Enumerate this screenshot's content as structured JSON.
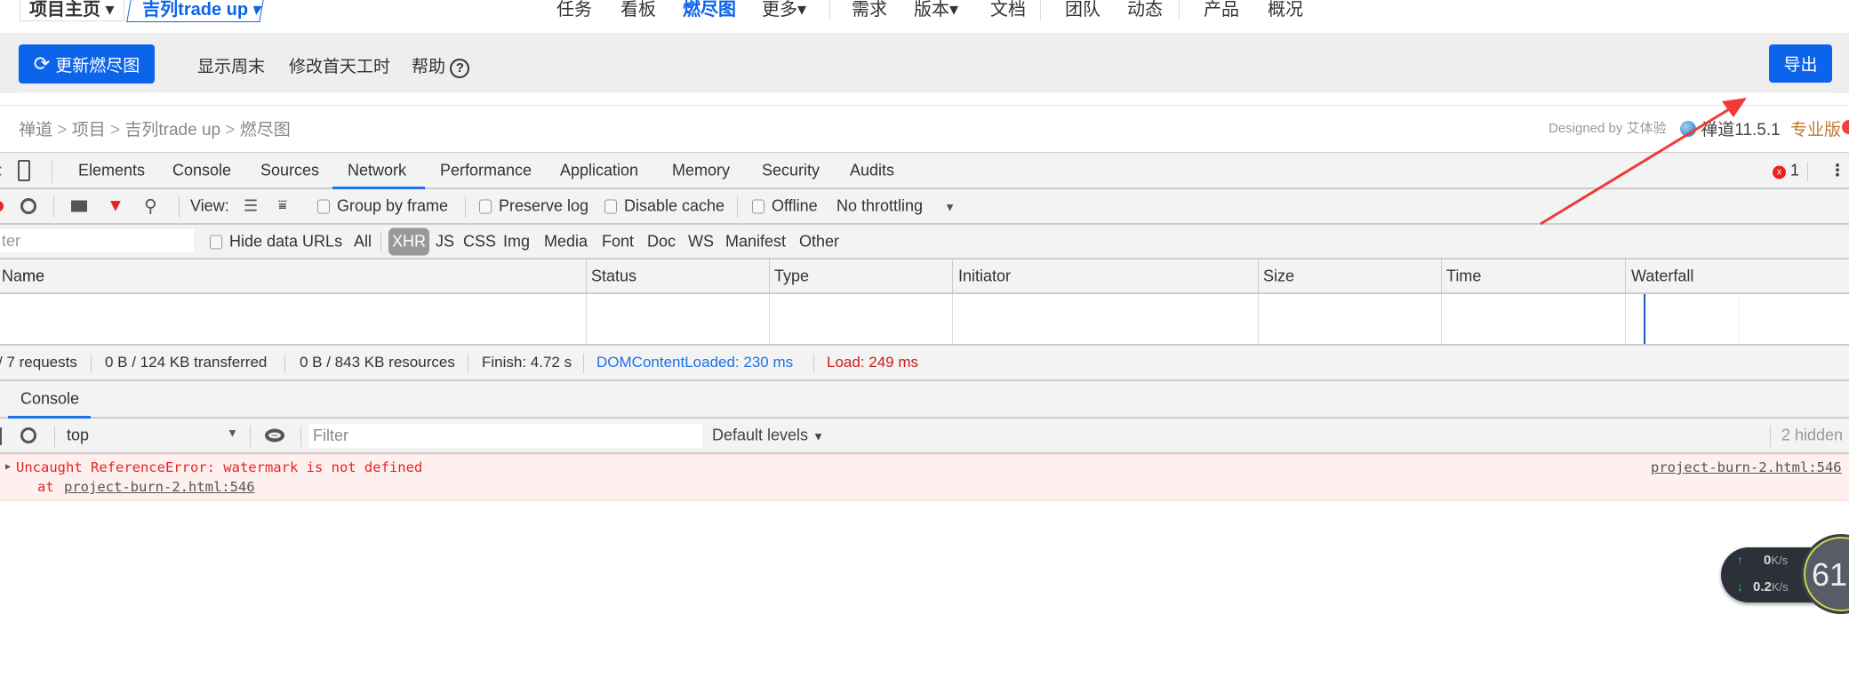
{
  "topnav": {
    "home": "项目主页",
    "project": "吉列trade up",
    "items": [
      "任务",
      "看板",
      "燃尽图",
      "更多",
      "需求",
      "版本",
      "文档",
      "团队",
      "动态",
      "产品",
      "概况"
    ],
    "active": "燃尽图"
  },
  "toolbar": {
    "refresh": "更新燃尽图",
    "show_weekend": "显示周末",
    "edit_hours": "修改首天工时",
    "help": "帮助",
    "export": "导出"
  },
  "breadcrumb": [
    "禅道",
    ">",
    "项目",
    ">",
    "吉列trade up",
    ">",
    "燃尽图"
  ],
  "footer": {
    "designed": "Designed by",
    "designer": "艾体验",
    "product": "禅道11.5.1",
    "edition": "专业版"
  },
  "devtools": {
    "tabs": [
      "Elements",
      "Console",
      "Sources",
      "Network",
      "Performance",
      "Application",
      "Memory",
      "Security",
      "Audits"
    ],
    "active_tab": "Network",
    "error_count": "1",
    "toolbar": {
      "view": "View:",
      "group": "Group by frame",
      "preserve": "Preserve log",
      "disable": "Disable cache",
      "offline": "Offline",
      "throttle": "No throttling"
    },
    "filter": {
      "placeholder": "Filter",
      "partial": "ter",
      "hide_data": "Hide data URLs",
      "types": [
        "All",
        "XHR",
        "JS",
        "CSS",
        "Img",
        "Media",
        "Font",
        "Doc",
        "WS",
        "Manifest",
        "Other"
      ],
      "active": "XHR"
    },
    "columns": [
      "Name",
      "Status",
      "Type",
      "Initiator",
      "Size",
      "Time",
      "Waterfall"
    ],
    "columns_visible_name": "me",
    "status": {
      "requests": "/ 7 requests",
      "transferred": "0 B / 124 KB transferred",
      "resources": "0 B / 843 KB resources",
      "finish": "Finish: 4.72 s",
      "dcl": "DOMContentLoaded: 230 ms",
      "load": "Load: 249 ms"
    },
    "drawer_tab": "Console",
    "console": {
      "context": "top",
      "filter_placeholder": "Filter",
      "levels": "Default levels",
      "hidden": "2 hidden",
      "error": "Uncaught ReferenceError: watermark is not defined",
      "at": "at",
      "location": "project-burn-2.html:546",
      "source": "project-burn-2.html:546"
    }
  },
  "widget": {
    "up": "0",
    "up_unit": "K/s",
    "down": "0.2",
    "down_unit": "K/s",
    "percent": "61"
  },
  "colors": {
    "accent": "#0c64eb",
    "error": "#e8231f",
    "annotation": "#f03a36"
  }
}
